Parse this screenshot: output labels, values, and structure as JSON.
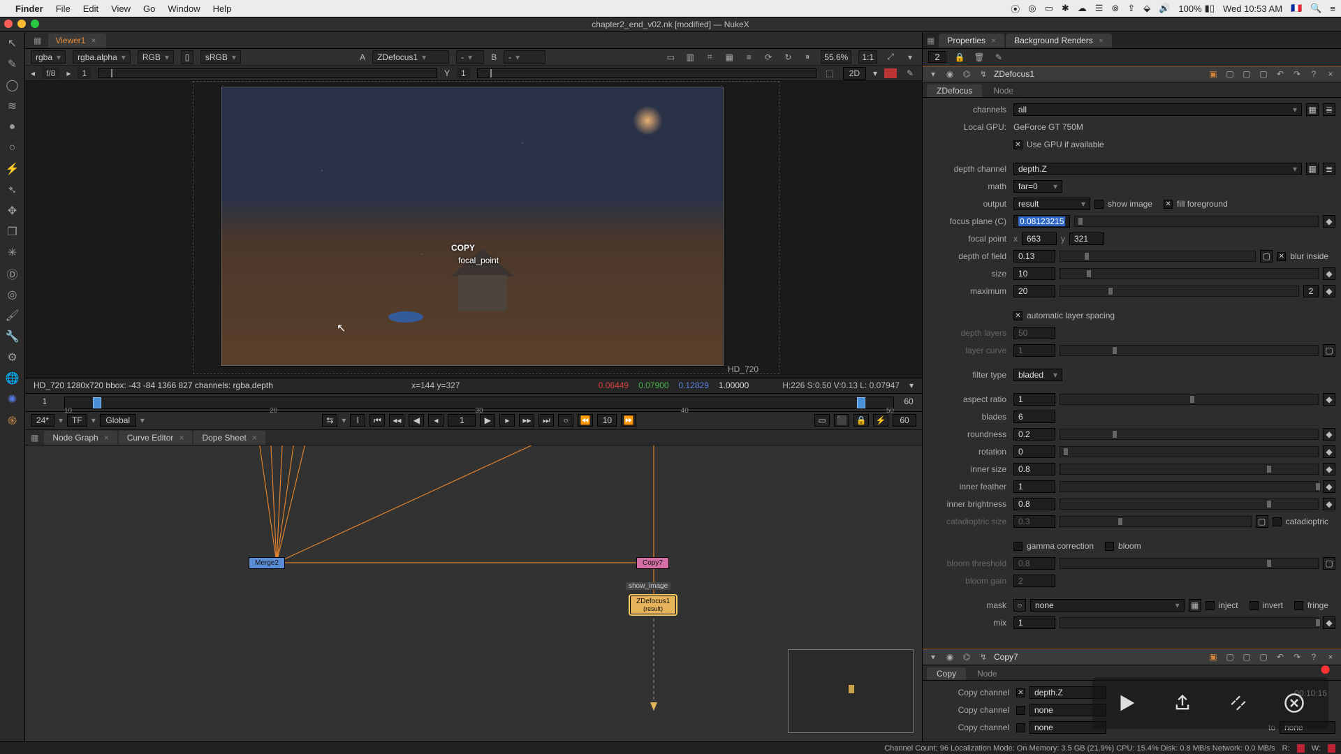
{
  "mac": {
    "app": "Finder",
    "menus": [
      "File",
      "Edit",
      "View",
      "Go",
      "Window",
      "Help"
    ],
    "battery": "100%",
    "clock": "Wed 10:53 AM",
    "flag": "🇫🇷"
  },
  "window_title": "chapter2_end_v02.nk [modified] — NukeX",
  "viewer": {
    "tab": "Viewer1",
    "layer": "rgba",
    "channels": "rgba.alpha",
    "color": "RGB",
    "lut": "sRGB",
    "ainput_prefix": "A",
    "ainput": "ZDefocus1",
    "ainput_sub": "-",
    "binput_prefix": "B",
    "binput": "-",
    "zoom": "55.6%",
    "ratio": "1:1",
    "fstop": "f/8",
    "frame_in": "1",
    "y_label": "Y",
    "mode_2d": "2D",
    "status_left": "HD_720 1280x720  bbox: -43 -84 1366 827 channels: rgba,depth",
    "status_xy": "x=144 y=327",
    "r": "0.06449",
    "g": "0.07900",
    "b": "0.12829",
    "a": "1.00000",
    "status_hsv": "H:226 S:0.50 V:0.13  L: 0.07947",
    "res_label": "HD_720",
    "overlay_copy": "COPY",
    "overlay_fp": "focal_point"
  },
  "timeline": {
    "start": "1",
    "end": "60",
    "ticks": [
      "10",
      "20",
      "30",
      "40",
      "50"
    ]
  },
  "playbar": {
    "fps": "24*",
    "tf": "TF",
    "scope": "Global",
    "cur": "1",
    "step": "10",
    "out": "60"
  },
  "lower_tabs": [
    "Node Graph",
    "Curve Editor",
    "Dope Sheet"
  ],
  "nodes": {
    "a": "Merge2",
    "copy": "Copy7",
    "show": "show_image",
    "zd": "ZDefocus1",
    "zdres": "(result)"
  },
  "right": {
    "tabs": [
      "Properties",
      "Background Renders"
    ],
    "count": "2"
  },
  "zd": {
    "name": "ZDefocus1",
    "tabs": [
      "ZDefocus",
      "Node"
    ],
    "channels": "all",
    "gpu_label": "Local GPU:",
    "gpu": "GeForce GT 750M",
    "use_gpu": "Use GPU if available",
    "depth_channel": "depth.Z",
    "math": "far=0",
    "output": "result",
    "show_image": "show image",
    "fill_fg": "fill foreground",
    "focus_plane_lab": "focus plane (C)",
    "focus_plane": "0.08123215",
    "focal_point_lab": "focal point",
    "fp_x_lab": "x",
    "fp_x": "663",
    "fp_y_lab": "y",
    "fp_y": "321",
    "dof_lab": "depth of field",
    "dof": "0.13",
    "blur_inside": "blur inside",
    "size_lab": "size",
    "size": "10",
    "max_lab": "maximum",
    "max": "20",
    "auto_layer": "automatic layer spacing",
    "depth_layers_lab": "depth layers",
    "depth_layers": "50",
    "layer_curve_lab": "layer curve",
    "layer_curve": "1",
    "filter_type_lab": "filter type",
    "filter_type": "bladed",
    "aspect_lab": "aspect ratio",
    "aspect": "1",
    "blades_lab": "blades",
    "blades": "6",
    "round_lab": "roundness",
    "round": "0.2",
    "rot_lab": "rotation",
    "rot": "0",
    "isize_lab": "inner size",
    "isize": "0.8",
    "ifeather_lab": "inner feather",
    "ifeather": "1",
    "ibright_lab": "inner brightness",
    "ibright": "0.8",
    "cata_lab": "catadioptric size",
    "cata": "0.3",
    "catadioptric": "catadioptric",
    "gamma": "gamma correction",
    "bloom": "bloom",
    "bthresh_lab": "bloom threshold",
    "bthresh": "0.8",
    "bgain_lab": "bloom gain",
    "bgain": "2",
    "mask_lab": "mask",
    "mask": "none",
    "inject": "inject",
    "invert": "invert",
    "fringe": "fringe",
    "mix_lab": "mix",
    "mix": "1"
  },
  "copy": {
    "name": "Copy7",
    "tabs": [
      "Copy",
      "Node"
    ],
    "cc_lab": "Copy channel",
    "c1": "depth.Z",
    "c2": "none",
    "c3": "none",
    "to": "to",
    "c4": "none"
  },
  "overlay": {
    "time": "00:10:16"
  },
  "status": {
    "left": "Channel Count: 96  Localization Mode: On  Memory: 3.5 GB (21.9%)  CPU: 15.4%  Disk: 0.8 MB/s  Network: 0.0 MB/s",
    "r": "R:",
    "w": "W:"
  }
}
